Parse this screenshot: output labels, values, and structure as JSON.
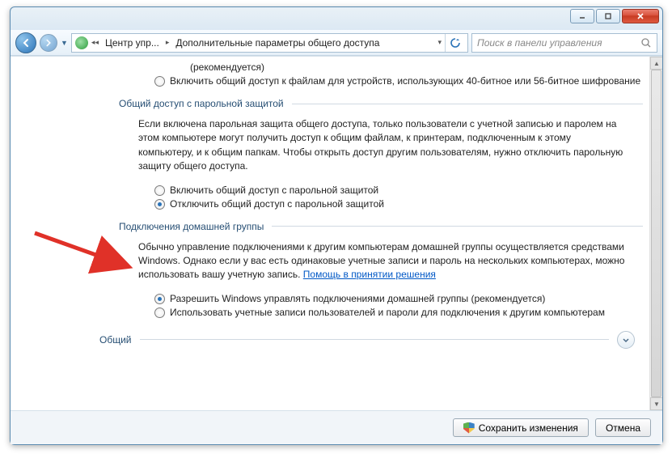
{
  "window": {
    "breadcrumb": {
      "root_tooltip": "Центр упр...",
      "current": "Дополнительные параметры общего доступа"
    },
    "search_placeholder": "Поиск в панели управления",
    "save_button": "Сохранить изменения",
    "cancel_button": "Отмена"
  },
  "content": {
    "top_fragment": {
      "recommended_note": "(рекомендуется)",
      "enable_40_56_option": "Включить общий доступ к файлам для устройств, использующих 40-битное или 56-битное шифрование"
    },
    "password_section": {
      "heading": "Общий доступ с парольной защитой",
      "description": "Если включена парольная защита общего доступа, только пользователи с учетной записью и паролем на этом компьютере могут получить доступ к общим файлам, к принтерам, подключенным к этому компьютеру, и к общим папкам. Чтобы открыть доступ другим пользователям, нужно отключить парольную защиту общего доступа.",
      "opt_enable": "Включить общий доступ с парольной защитой",
      "opt_disable": "Отключить общий доступ с парольной защитой",
      "selected": "disable"
    },
    "homegroup_section": {
      "heading": "Подключения домашней группы",
      "description_pre": "Обычно управление подключениями к другим компьютерам домашней группы осуществляется средствами Windows. Однако если у вас есть одинаковые учетные записи и пароль на нескольких компьютерах, можно использовать вашу учетную запись. ",
      "help_link": "Помощь в принятии решения",
      "opt_windows": "Разрешить Windows управлять подключениями домашней группы (рекомендуется)",
      "opt_user": "Использовать учетные записи пользователей и пароли для подключения к другим компьютерам",
      "selected": "windows"
    },
    "collapsed_section": {
      "title": "Общий"
    }
  }
}
